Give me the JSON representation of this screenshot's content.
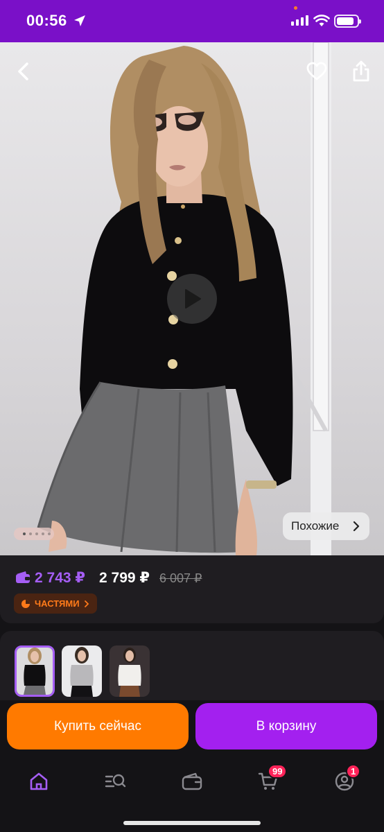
{
  "status_bar": {
    "time": "00:56",
    "bg_color": "#7a10c8"
  },
  "product_media": {
    "similar_label": "Похожие",
    "icons": [
      "back-icon",
      "heart-icon",
      "share-icon",
      "play-icon",
      "chevron-right-icon"
    ],
    "page_count": 5,
    "active_page": 1
  },
  "pricing": {
    "wallet_price": "2 743 ₽",
    "card_price": "2 799 ₽",
    "old_price": "6 007 ₽",
    "installments_label": "ЧАСТЯМИ",
    "wallet_color": "#a55ef5",
    "installments_color": "#ff7a1a"
  },
  "variants": {
    "colors": [
      "black",
      "gray",
      "white"
    ],
    "selected_index": 0
  },
  "actions": {
    "buy_now_label": "Купить сейчас",
    "add_to_cart_label": "В корзину",
    "buy_now_color": "#ff7a00",
    "add_to_cart_color": "#a320ef"
  },
  "bottom_nav": {
    "items": [
      {
        "icon": "home-icon",
        "active": true
      },
      {
        "icon": "catalog-search-icon"
      },
      {
        "icon": "wallet-icon"
      },
      {
        "icon": "cart-icon",
        "badge": "99"
      },
      {
        "icon": "profile-icon",
        "badge": "1"
      }
    ],
    "active_color": "#a55ef5",
    "badge_color": "#ff2359"
  }
}
